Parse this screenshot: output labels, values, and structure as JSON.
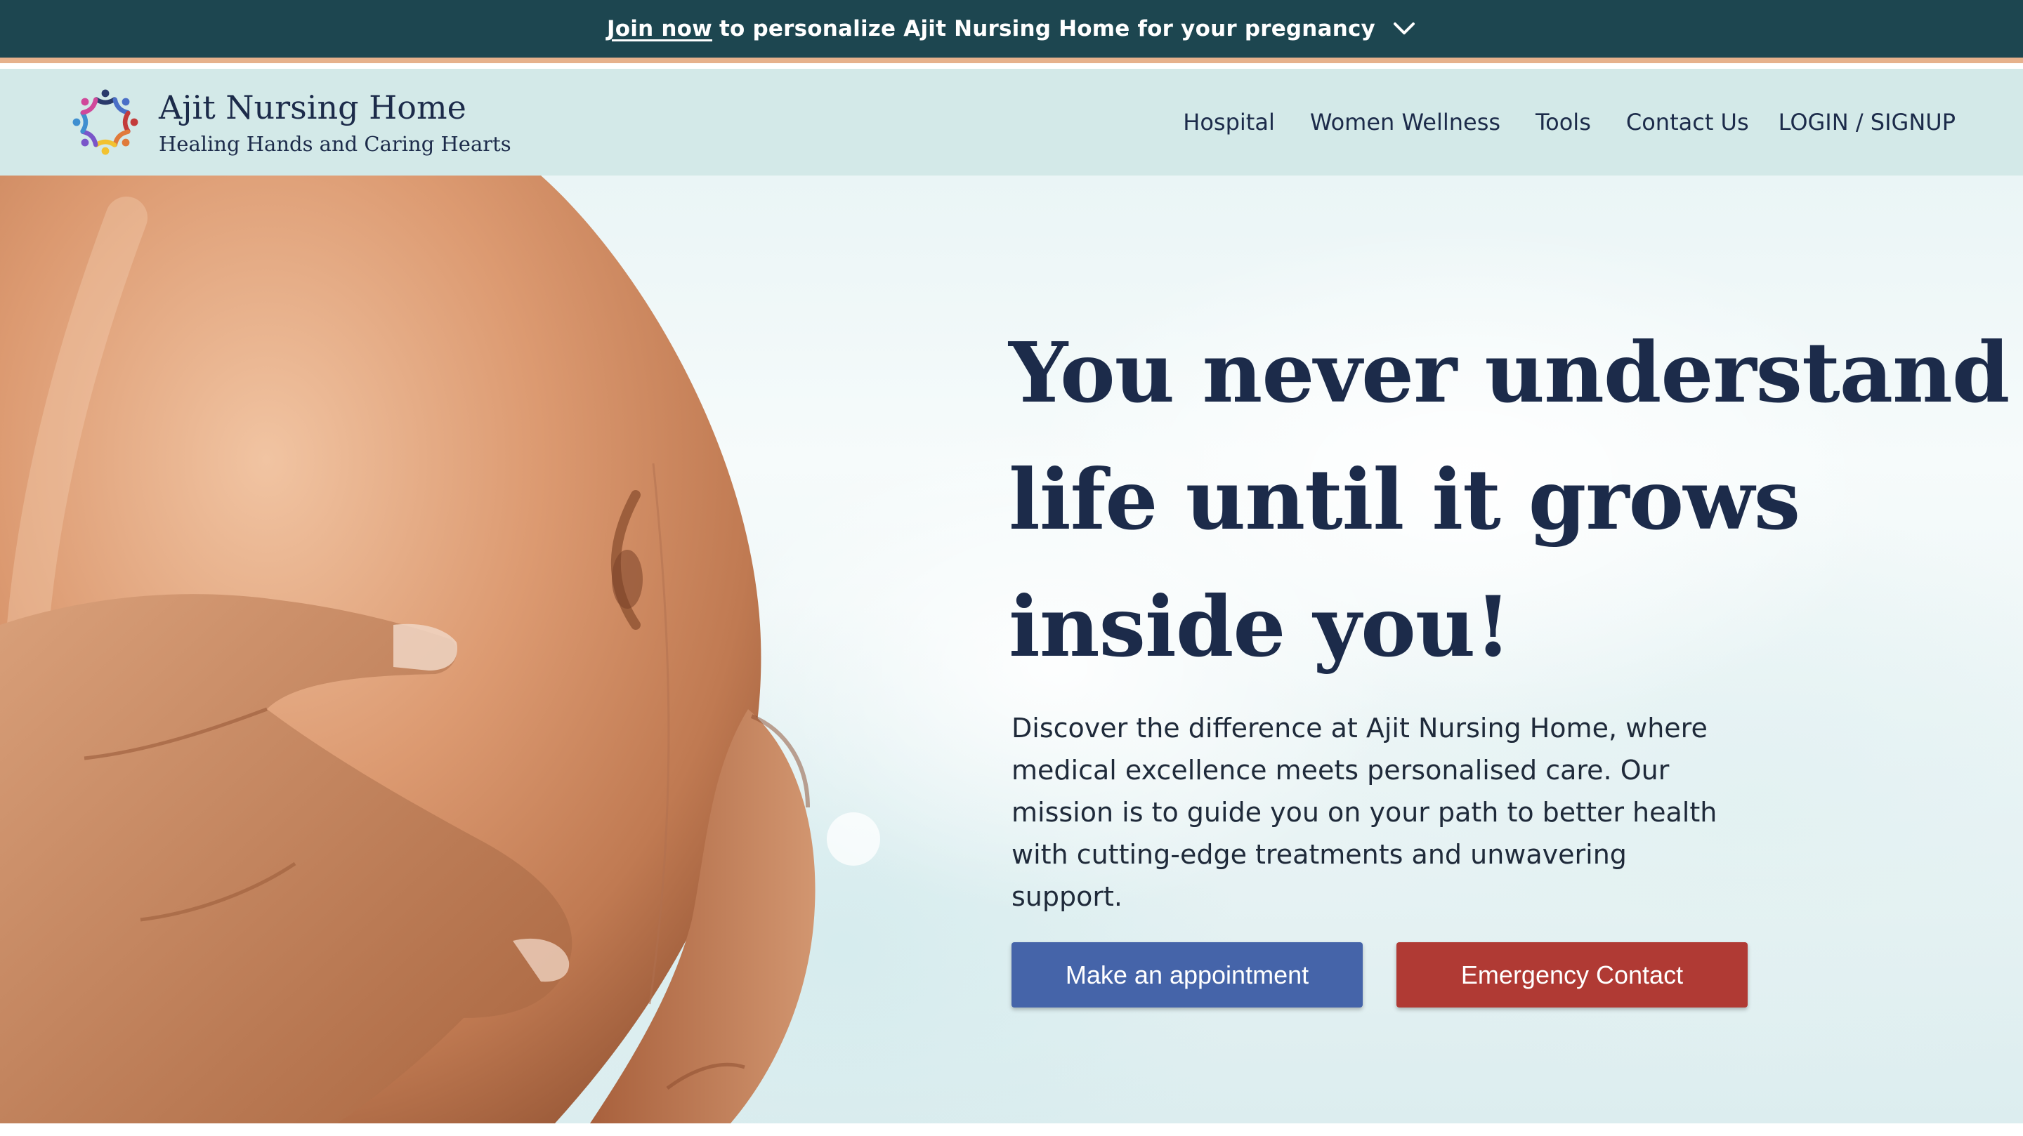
{
  "announcement": {
    "link_text": "Join now",
    "text": "to personalize Ajit Nursing Home for your pregnancy",
    "toggle_icon": "chevron-down-icon"
  },
  "brand": {
    "name": "Ajit Nursing Home",
    "tagline": "Healing Hands and Caring Hearts",
    "logo_icon": "people-circle-logo"
  },
  "nav": {
    "items": [
      {
        "label": "Hospital"
      },
      {
        "label": "Women Wellness"
      },
      {
        "label": "Tools"
      },
      {
        "label": "Contact Us"
      },
      {
        "label": "LOGIN / SIGNUP"
      }
    ]
  },
  "hero": {
    "headline_lines": [
      "You never understand",
      "life until it grows",
      "inside you!"
    ],
    "intro": "Discover the difference at Ajit Nursing Home, where medical excellence meets personalised care. Our mission is to guide you on your path to better health with cutting-edge treatments and unwavering support.",
    "primary_button": "Make an appointment",
    "secondary_button": "Emergency Contact"
  },
  "colors": {
    "announcement_bg": "#1d4650",
    "announcement_border": "#e6b18c",
    "header_bg": "#d3e9e8",
    "text_navy": "#1c2b4a",
    "primary_button": "#4564a9",
    "emergency_button": "#b03a34"
  }
}
